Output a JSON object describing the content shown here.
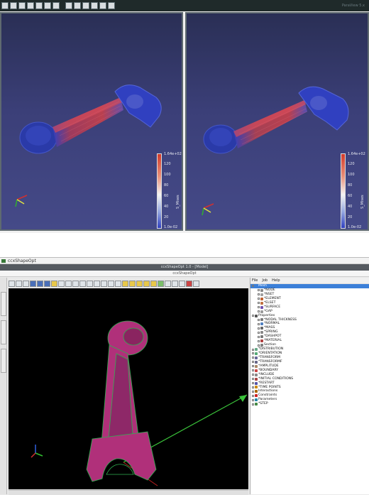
{
  "top": {
    "status_text": "ParaView 5.x",
    "left_view": {
      "colorbar": {
        "max": "1.64e+02",
        "ticks": [
          "120",
          "100",
          "80",
          "60",
          "40",
          "20"
        ],
        "min": "1.0e-02",
        "title": "S_Mises"
      },
      "axes_labels": [
        "X",
        "Y",
        "Z"
      ]
    },
    "right_view": {
      "colorbar": {
        "max": "1.64e+02",
        "ticks": [
          "120",
          "100",
          "80",
          "60",
          "40",
          "20"
        ],
        "min": "1.0e-02",
        "title": "S_Mises"
      },
      "axes_labels": [
        "X",
        "Y",
        "Z"
      ]
    },
    "colors": {
      "mesh_high": "#d23a2a",
      "mesh_low": "#3040c0",
      "background": "#3b3f78"
    }
  },
  "bottom": {
    "window_title": "ccxShapeOpt",
    "app_title": "ccxShapeOpt 1.0 - [Model]",
    "subtitle": "ccxShapeOpt",
    "left_tabs": [
      "Results",
      "Mesh",
      "Model"
    ],
    "menu": [
      "File",
      "Job",
      "Help"
    ],
    "tree": [
      {
        "label": "Mesh",
        "level": 0,
        "icon": "mesh-icon",
        "selected": true
      },
      {
        "label": "*NODE",
        "level": 1,
        "icon": "node-icon"
      },
      {
        "label": "*NSET",
        "level": 1,
        "icon": "nset-icon"
      },
      {
        "label": "*ELEMENT",
        "level": 1,
        "icon": "element-icon"
      },
      {
        "label": "*ELSET",
        "level": 1,
        "icon": "elset-icon"
      },
      {
        "label": "*SURFACE",
        "level": 1,
        "icon": "surface-icon"
      },
      {
        "label": "*GAP",
        "level": 1,
        "icon": "gap-icon"
      },
      {
        "label": "Properties",
        "level": 0,
        "icon": "properties-icon"
      },
      {
        "label": "*NODAL THICKNESS",
        "level": 1,
        "icon": "thickness-icon"
      },
      {
        "label": "*NORMAL",
        "level": 1,
        "icon": "normal-icon"
      },
      {
        "label": "*MASS",
        "level": 1,
        "icon": "mass-icon"
      },
      {
        "label": "*SPRING",
        "level": 1,
        "icon": "spring-icon"
      },
      {
        "label": "*DASHPOT",
        "level": 1,
        "icon": "dashpot-icon"
      },
      {
        "label": "*MATERIAL",
        "level": 1,
        "icon": "material-icon"
      },
      {
        "label": "Section",
        "level": 1,
        "icon": "section-icon"
      },
      {
        "label": "*DISTRIBUTION",
        "level": 0,
        "icon": "distribution-icon"
      },
      {
        "label": "*ORIENTATION",
        "level": 0,
        "icon": "orientation-icon"
      },
      {
        "label": "*TRANSFORM",
        "level": 0,
        "icon": "transform-icon"
      },
      {
        "label": "*TRANSFORMF",
        "level": 0,
        "icon": "transformf-icon"
      },
      {
        "label": "*AMPLITUDE",
        "level": 0,
        "icon": "amplitude-icon"
      },
      {
        "label": "*BOUNDARY",
        "level": 0,
        "icon": "boundary-icon"
      },
      {
        "label": "*INCLUDE",
        "level": 0,
        "icon": "include-icon"
      },
      {
        "label": "*INITIAL CONDITIONS",
        "level": 0,
        "icon": "initial-conditions-icon"
      },
      {
        "label": "*RESTART",
        "level": 0,
        "icon": "restart-icon"
      },
      {
        "label": "*TIME POINTS",
        "level": 0,
        "icon": "time-points-icon"
      },
      {
        "label": "Interactions",
        "level": 0,
        "icon": "interactions-icon"
      },
      {
        "label": "Constraints",
        "level": 0,
        "icon": "constraints-icon"
      },
      {
        "label": "Parameters",
        "level": 0,
        "icon": "parameters-icon"
      },
      {
        "label": "*STEP",
        "level": 0,
        "icon": "step-icon"
      }
    ],
    "colors": {
      "part": "#b0307a",
      "part_edge": "#2fb050",
      "canvas": "#000000",
      "selection": "#3b7fd8",
      "green_arrow": "#3ac23a"
    }
  }
}
